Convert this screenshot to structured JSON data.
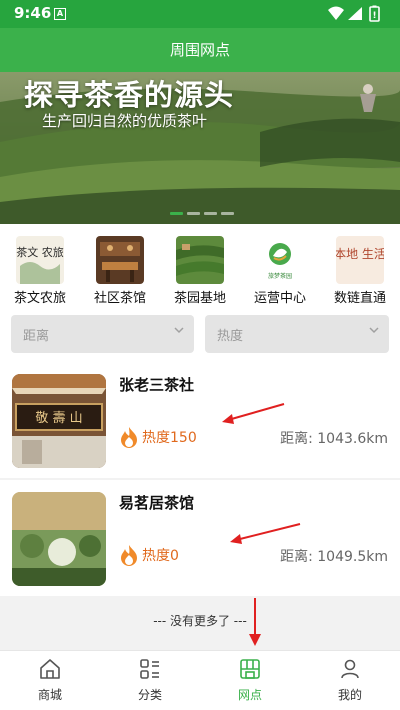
{
  "status": {
    "time": "9:46",
    "a_badge": "A"
  },
  "header": {
    "title": "周围网点"
  },
  "banner": {
    "title": "探寻茶香的源头",
    "subtitle": "生产回归自然的优质茶叶",
    "slides": 4,
    "active_slide": 1
  },
  "categories": [
    {
      "label": "茶文农旅",
      "icon_text": "茶文 农旅",
      "icon": "tea-culture-icon"
    },
    {
      "label": "社区茶馆",
      "icon": "teahouse-photo-icon"
    },
    {
      "label": "茶园基地",
      "icon": "tea-garden-photo-icon"
    },
    {
      "label": "运营中心",
      "icon_text": "旅梦茶园",
      "icon": "operation-center-logo-icon"
    },
    {
      "label": "数链直通",
      "icon_text": "本地 生活",
      "icon": "local-life-icon"
    }
  ],
  "filters": {
    "distance": "距离",
    "heat": "热度"
  },
  "shops": [
    {
      "name": "张老三茶社",
      "heat": "热度150",
      "distance": "距离: 1043.6km",
      "sign_text": "敬 壽 山"
    },
    {
      "name": "易茗居茶馆",
      "heat": "热度0",
      "distance": "距离: 1049.5km"
    }
  ],
  "list_end": "--- 没有更多了 ---",
  "tabs": [
    {
      "label": "商城",
      "icon": "home-icon"
    },
    {
      "label": "分类",
      "icon": "category-icon"
    },
    {
      "label": "网点",
      "icon": "outlets-icon",
      "active": true
    },
    {
      "label": "我的",
      "icon": "profile-icon"
    }
  ],
  "colors": {
    "primary": "#3bb14b",
    "status_bar": "#27a53e",
    "heat": "#e0691d",
    "arrow": "#e02020"
  }
}
